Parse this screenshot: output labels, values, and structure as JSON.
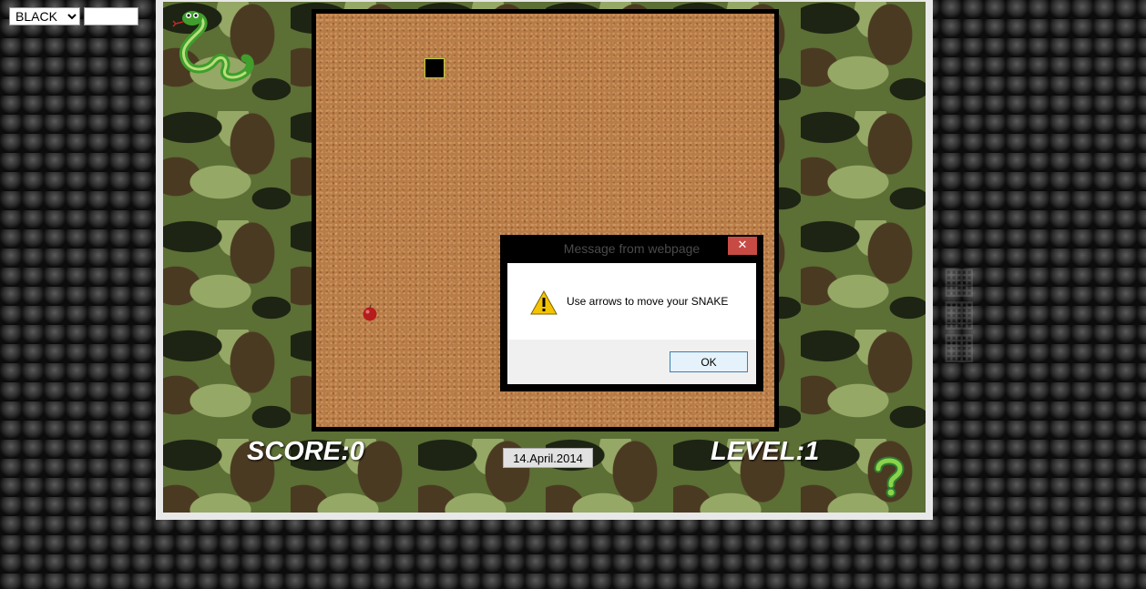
{
  "controls": {
    "color_select": {
      "selected": "BLACK",
      "options": [
        "BLACK"
      ]
    },
    "text_input": {
      "value": ""
    }
  },
  "game": {
    "score_text": "SCORE:0",
    "level_text": "LEVEL:1",
    "date_button": "14.April.2014",
    "icons": {
      "logo": "snake-logo-icon",
      "food": "apple-icon",
      "help": "question-mark-icon"
    }
  },
  "dialog": {
    "title": "Message from webpage",
    "close_glyph": "✕",
    "message": "Use arrows to move your SNAKE",
    "ok_label": "OK",
    "icon": "warning-icon"
  },
  "colors": {
    "snake_border": "#b6d23c",
    "board": "#b97c47",
    "camo": "#5c6f35"
  }
}
